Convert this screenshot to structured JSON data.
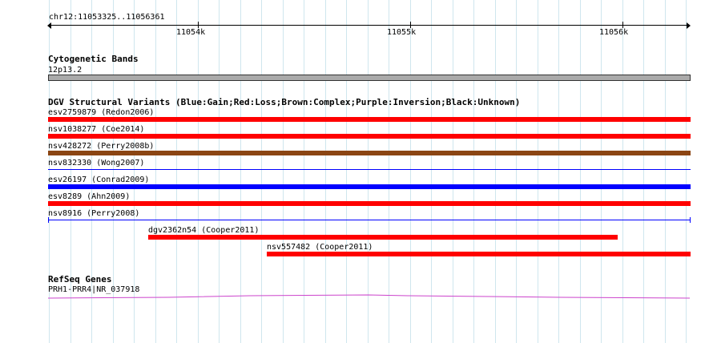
{
  "ruler": {
    "region": "chr12:11053325..11056361",
    "ticks": [
      "11054k",
      "11055k",
      "11056k"
    ]
  },
  "cytoband": {
    "title": "Cytogenetic Bands",
    "band": "12p13.2"
  },
  "dgv": {
    "title": "DGV Structural Variants (Blue:Gain;Red:Loss;Brown:Complex;Purple:Inversion;Black:Unknown)",
    "variants": [
      {
        "label": "esv2759879 (Redon2006)",
        "color": "#ff0000"
      },
      {
        "label": "nsv1038277 (Coe2014)",
        "color": "#ff0000"
      },
      {
        "label": "nsv428272 (Perry2008b)",
        "color": "#8b4513"
      },
      {
        "label": "nsv832330 (Wong2007)",
        "color": "#0000ff"
      },
      {
        "label": "esv26197 (Conrad2009)",
        "color": "#0000ff"
      },
      {
        "label": "esv8289 (Ahn2009)",
        "color": "#ff0000"
      },
      {
        "label": "nsv8916 (Perry2008)",
        "color": "#0000ff"
      },
      {
        "label": "dgv2362n54 (Cooper2011)",
        "color": "#ff0000"
      },
      {
        "label": "nsv557482 (Cooper2011)",
        "color": "#ff0000"
      }
    ]
  },
  "refseq": {
    "title": "RefSeq Genes",
    "gene": "PRH1-PRR4|NR_037918",
    "color": "#cc44cc"
  }
}
